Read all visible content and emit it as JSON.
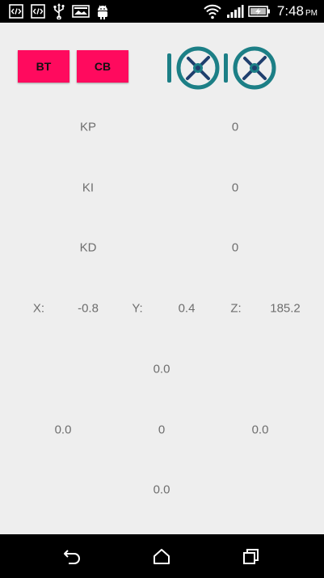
{
  "status_bar": {
    "time": "7:48",
    "ampm": "PM",
    "icons": [
      "code-icon",
      "code-icon",
      "usb-icon",
      "image-icon",
      "android-icon",
      "wifi-icon",
      "signal-icon",
      "battery-charging-icon"
    ]
  },
  "buttons": {
    "bt_label": "BT",
    "cb_label": "CB"
  },
  "logo": {
    "name": "quadcopter-logo",
    "accent": "#1c7f86",
    "dark": "#1f3f6e"
  },
  "pid": {
    "kp_label": "KP",
    "kp_value": "0",
    "ki_label": "KI",
    "ki_value": "0",
    "kd_label": "KD",
    "kd_value": "0"
  },
  "orientation": {
    "x_label": "X:",
    "x_value": "-0.8",
    "y_label": "Y:",
    "y_value": "0.4",
    "z_label": "Z:",
    "z_value": "185.2"
  },
  "motors": {
    "top": "0.0",
    "left": "0.0",
    "center": "0",
    "right": "0.0",
    "bottom": "0.0"
  },
  "colors": {
    "button_bg": "#ff0a5e",
    "text": "#6e6e6e",
    "background": "#eeeeee"
  },
  "nav_bar": {
    "icons": [
      "back-icon",
      "home-icon",
      "recent-apps-icon"
    ]
  }
}
